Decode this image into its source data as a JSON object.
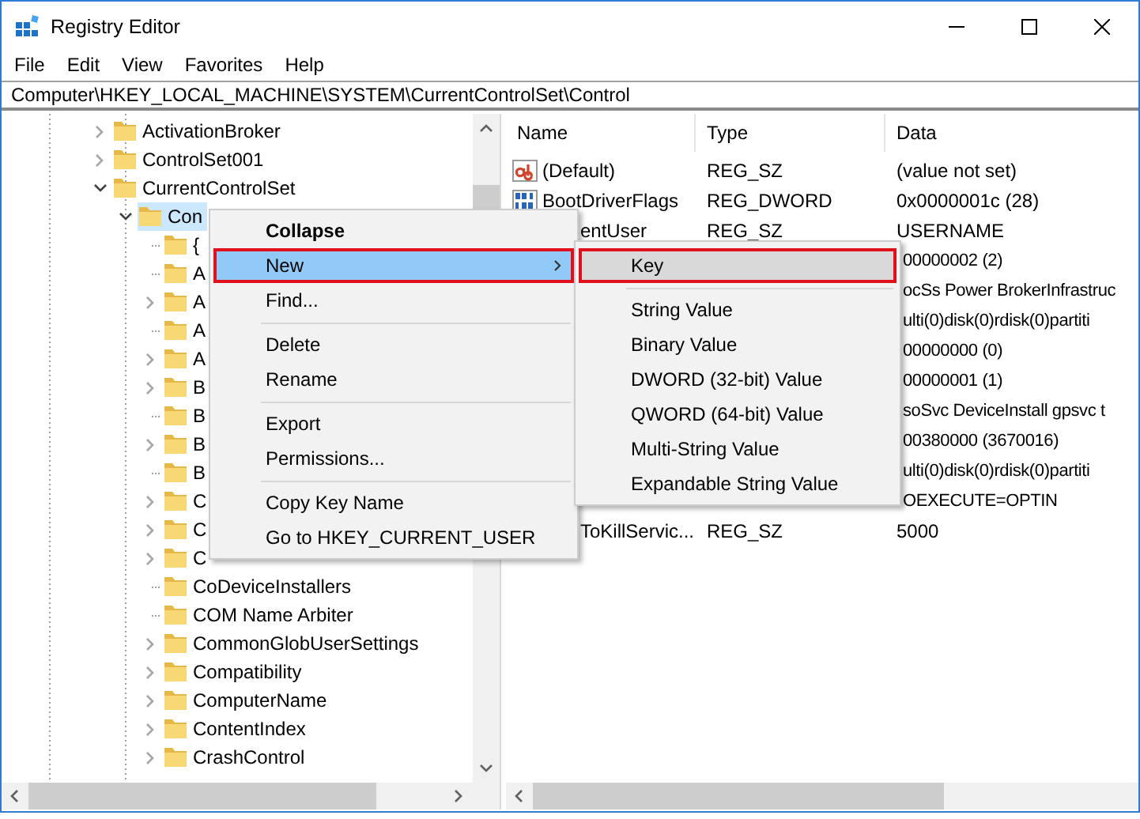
{
  "window": {
    "title": "Registry Editor"
  },
  "menu_bar": [
    "File",
    "Edit",
    "View",
    "Favorites",
    "Help"
  ],
  "address_bar": "Computer\\HKEY_LOCAL_MACHINE\\SYSTEM\\CurrentControlSet\\Control",
  "tree": [
    {
      "label": "ActivationBroker",
      "expanded": false,
      "selected": false
    },
    {
      "label": "ControlSet001",
      "expanded": false,
      "selected": false
    },
    {
      "label": "CurrentControlSet",
      "expanded": true,
      "selected": false,
      "children": [
        {
          "label": "Con",
          "expanded": true,
          "selected": true,
          "children": [
            {
              "label": "{",
              "selected": false
            },
            {
              "label": "A",
              "selected": false
            },
            {
              "label": "A",
              "expanded": false,
              "selected": false
            },
            {
              "label": "A",
              "selected": false
            },
            {
              "label": "A",
              "expanded": false,
              "selected": false
            },
            {
              "label": "B",
              "expanded": false,
              "selected": false
            },
            {
              "label": "B",
              "selected": false
            },
            {
              "label": "B",
              "expanded": false,
              "selected": false
            },
            {
              "label": "B",
              "selected": false
            },
            {
              "label": "C",
              "expanded": false,
              "selected": false
            },
            {
              "label": "C",
              "expanded": false,
              "selected": false
            },
            {
              "label": "C",
              "expanded": false,
              "selected": false
            },
            {
              "label": "CoDeviceInstallers",
              "selected": false
            },
            {
              "label": "COM Name Arbiter",
              "selected": false
            },
            {
              "label": "CommonGlobUserSettings",
              "expanded": false,
              "selected": false
            },
            {
              "label": "Compatibility",
              "expanded": false,
              "selected": false
            },
            {
              "label": "ComputerName",
              "expanded": false,
              "selected": false
            },
            {
              "label": "ContentIndex",
              "expanded": false,
              "selected": false
            },
            {
              "label": "CrashControl",
              "expanded": false,
              "selected": false
            }
          ]
        }
      ]
    }
  ],
  "list": {
    "columns": [
      "Name",
      "Type",
      "Data"
    ],
    "rows": [
      {
        "kind": "string",
        "name": "(Default)",
        "type": "REG_SZ",
        "data": "(value not set)"
      },
      {
        "kind": "binary",
        "name": "BootDriverFlags",
        "type": "REG_DWORD",
        "data": "0x0000001c (28)"
      },
      {
        "name": "entUser",
        "type": "REG_SZ",
        "data": "USERNAME"
      },
      {
        "data": "00000002 (2)"
      },
      {
        "data": "ocSs Power BrokerInfrastruc"
      },
      {
        "data": "ulti(0)disk(0)rdisk(0)partiti"
      },
      {
        "data": "00000000 (0)"
      },
      {
        "data": "00000001 (1)"
      },
      {
        "data": "soSvc DeviceInstall gpsvc t"
      },
      {
        "data": "00380000 (3670016)"
      },
      {
        "data": "ulti(0)disk(0)rdisk(0)partiti"
      },
      {
        "data": "OEXECUTE=OPTIN"
      },
      {
        "name": "ToKillServic...",
        "type": "REG_SZ",
        "data": "5000"
      }
    ]
  },
  "context_menu": {
    "items": [
      {
        "kind": "item",
        "label": "Collapse",
        "default": true,
        "selected": false,
        "marked": false
      },
      {
        "kind": "item",
        "label": "New",
        "submenu": true,
        "default": false,
        "selected": true,
        "marked": true
      },
      {
        "kind": "item",
        "label": "Find...",
        "default": false,
        "selected": false,
        "marked": false
      },
      {
        "kind": "separator"
      },
      {
        "kind": "item",
        "label": "Delete",
        "default": false,
        "selected": false,
        "marked": false
      },
      {
        "kind": "item",
        "label": "Rename",
        "default": false,
        "selected": false,
        "marked": false
      },
      {
        "kind": "separator"
      },
      {
        "kind": "item",
        "label": "Export",
        "default": false,
        "selected": false,
        "marked": false
      },
      {
        "kind": "item",
        "label": "Permissions...",
        "default": false,
        "selected": false,
        "marked": false
      },
      {
        "kind": "separator"
      },
      {
        "kind": "item",
        "label": "Copy Key Name",
        "default": false,
        "selected": false,
        "marked": false
      },
      {
        "kind": "item",
        "label": "Go to HKEY_CURRENT_USER",
        "default": false,
        "selected": false,
        "marked": false
      }
    ]
  },
  "submenu": {
    "items": [
      {
        "kind": "item",
        "label": "Key",
        "selected": true,
        "marked": true
      },
      {
        "kind": "separator"
      },
      {
        "kind": "item",
        "label": "String Value",
        "selected": false,
        "marked": false
      },
      {
        "kind": "item",
        "label": "Binary Value",
        "selected": false,
        "marked": false
      },
      {
        "kind": "item",
        "label": "DWORD (32-bit) Value",
        "selected": false,
        "marked": false
      },
      {
        "kind": "item",
        "label": "QWORD (64-bit) Value",
        "selected": false,
        "marked": false
      },
      {
        "kind": "item",
        "label": "Multi-String Value",
        "selected": false,
        "marked": false
      },
      {
        "kind": "item",
        "label": "Expandable String Value",
        "selected": false,
        "marked": false
      }
    ]
  }
}
